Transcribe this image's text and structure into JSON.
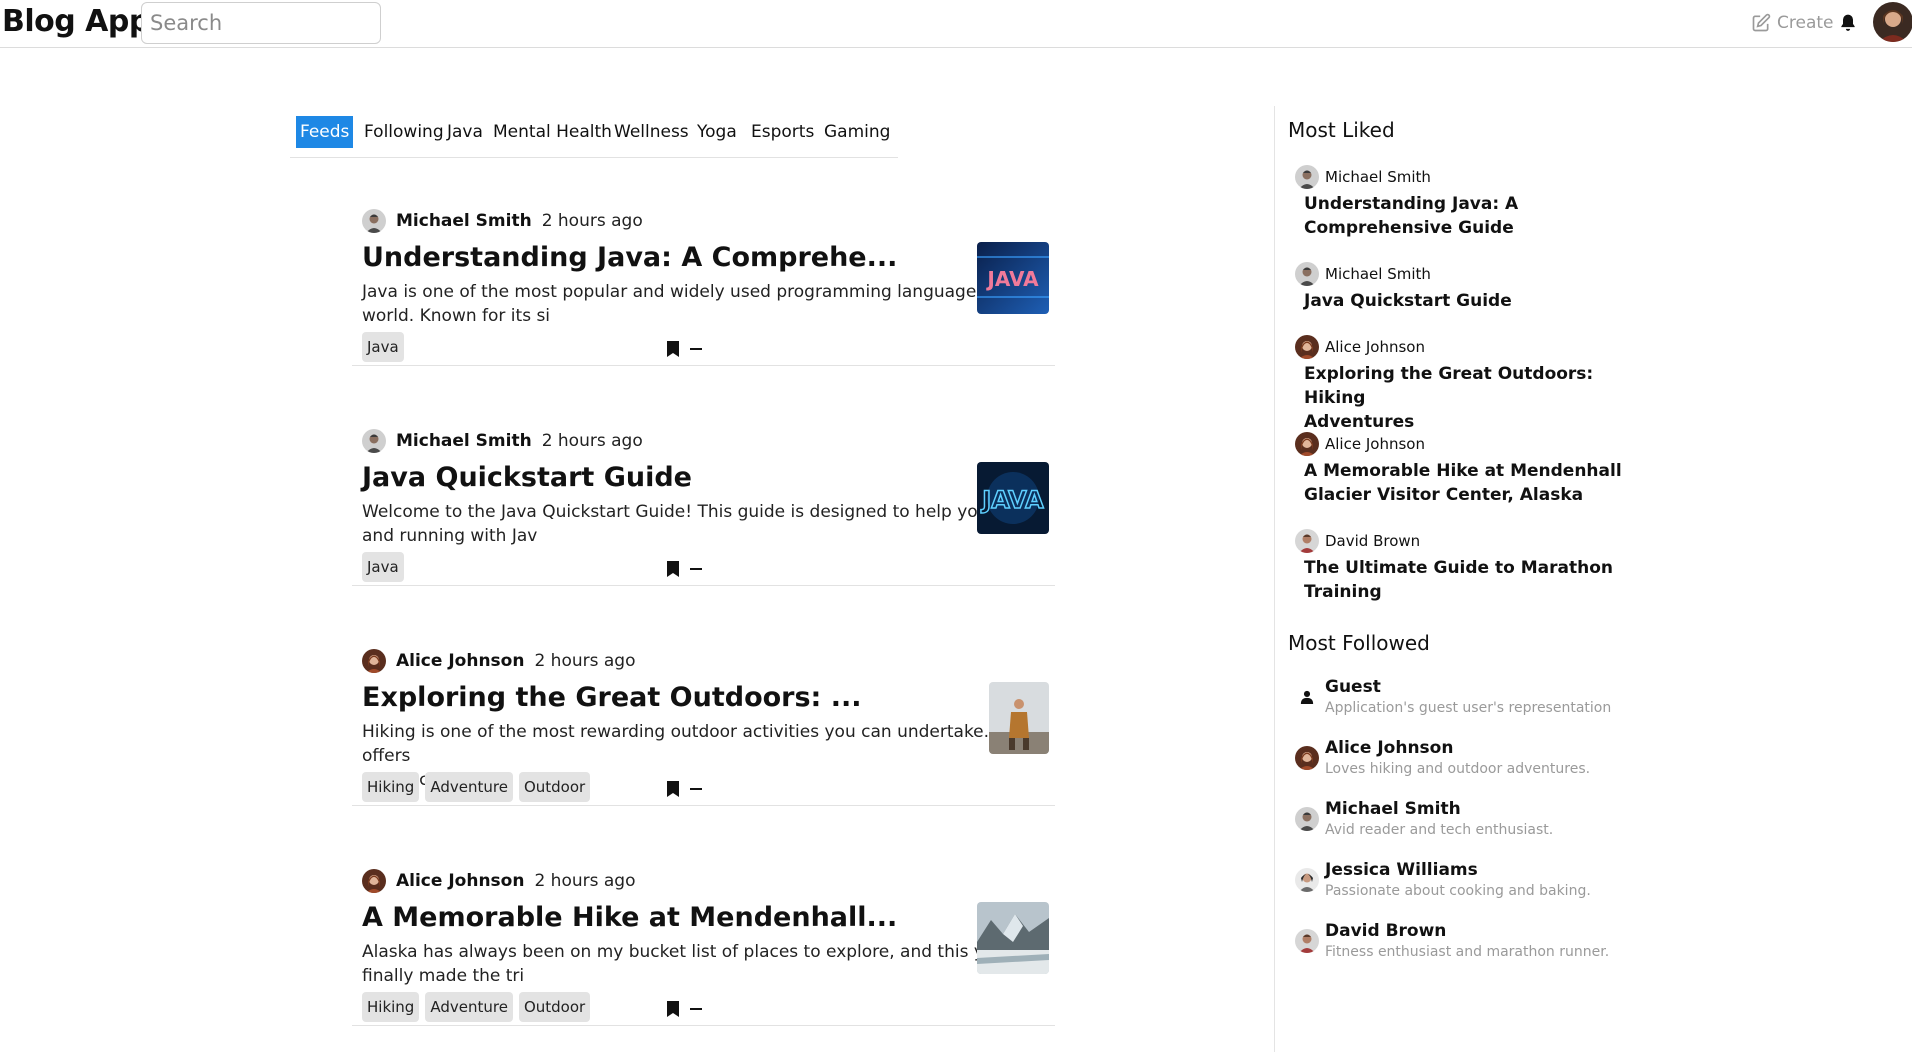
{
  "header": {
    "brand": "Blog App",
    "search_placeholder": "Search",
    "create_label": "Create"
  },
  "tabs": [
    "Feeds",
    "Following",
    "Java",
    "Mental Health",
    "Wellness",
    "Yoga",
    "Esports",
    "Gaming"
  ],
  "active_tab": "Feeds",
  "posts": [
    {
      "author": "Michael Smith",
      "time": "2 hours ago",
      "title": "Understanding Java: A Comprehe...",
      "excerpt_line1": "Java is one of the most popular and widely used programming languages in the",
      "excerpt_line2": "world. Known for its si",
      "tags": [
        "Java"
      ]
    },
    {
      "author": "Michael Smith",
      "time": "2 hours ago",
      "title": "Java Quickstart Guide",
      "excerpt_line1": "Welcome to the Java Quickstart Guide! This guide is designed to help you get up",
      "excerpt_line2": "and running with Jav",
      "tags": [
        "Java"
      ]
    },
    {
      "author": "Alice Johnson",
      "time": "2 hours ago",
      "title": "Exploring the Great Outdoors: ...",
      "excerpt_line1": "Hiking is one of the most rewarding outdoor activities you can undertake. It offers",
      "excerpt_line2": "a chance to disc",
      "tags": [
        "Hiking",
        "Adventure",
        "Outdoor"
      ]
    },
    {
      "author": "Alice Johnson",
      "time": "2 hours ago",
      "title": "A Memorable Hike at Mendenhall...",
      "excerpt_line1": "Alaska has always been on my bucket list of places to explore, and this year, I",
      "excerpt_line2": "finally made the tri",
      "tags": [
        "Hiking",
        "Adventure",
        "Outdoor"
      ]
    }
  ],
  "sidebar": {
    "most_liked_heading": "Most Liked",
    "most_liked": [
      {
        "author": "Michael Smith",
        "title_line1": "Understanding Java: A",
        "title_line2": "Comprehensive Guide"
      },
      {
        "author": "Michael Smith",
        "title_line1": "Java Quickstart Guide",
        "title_line2": ""
      },
      {
        "author": "Alice Johnson",
        "title_line1": "Exploring the Great Outdoors: Hiking",
        "title_line2": "Adventures"
      },
      {
        "author": "Alice Johnson",
        "title_line1": "A Memorable Hike at Mendenhall",
        "title_line2": "Glacier Visitor Center, Alaska"
      },
      {
        "author": "David Brown",
        "title_line1": "The Ultimate Guide to Marathon",
        "title_line2": "Training"
      }
    ],
    "most_followed_heading": "Most Followed",
    "most_followed": [
      {
        "name": "Guest",
        "bio": "Application's guest user's representation"
      },
      {
        "name": "Alice Johnson",
        "bio": "Loves hiking and outdoor adventures."
      },
      {
        "name": "Michael Smith",
        "bio": "Avid reader and tech enthusiast."
      },
      {
        "name": "Jessica Williams",
        "bio": "Passionate about cooking and baking."
      },
      {
        "name": "David Brown",
        "bio": "Fitness enthusiast and marathon runner."
      }
    ]
  },
  "colors": {
    "accent": "#1e88e5",
    "tag_bg": "#e3e3e3",
    "muted": "#9a9a9a"
  }
}
